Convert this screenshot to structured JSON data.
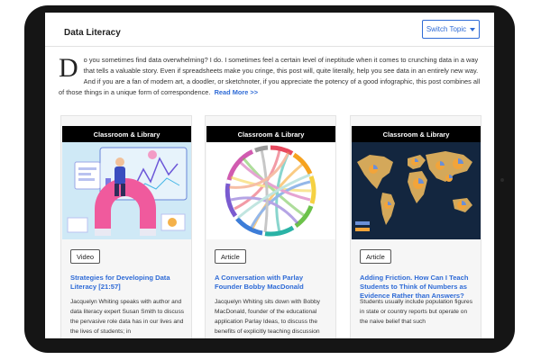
{
  "page": {
    "title": "Data Literacy",
    "switch_topic_label": "Switch Topic"
  },
  "intro": {
    "dropcap": "D",
    "text": "o you sometimes find data overwhelming? I do. I sometimes feel a certain level of ineptitude when it comes to crunching data in a way that tells a valuable story. Even if spreadsheets make you cringe, this post will, quite literally, help you see data in an entirely new way. And if you are a fan of modern art, a doodler, or sketchnoter, if you appreciate the potency of a good infographic, this post combines all of those things in a unique form of correspondence.",
    "read_more": "Read More >>"
  },
  "cards": [
    {
      "category": "Classroom & Library",
      "type": "Video",
      "title": "Strategies for Developing Data Literacy [21:57]",
      "description": "Jacquelyn Whiting speaks with author and data literacy expert Susan Smith to discuss the pervasive role data has in our lives and the lives of students; in"
    },
    {
      "category": "Classroom & Library",
      "type": "Article",
      "title": "A Conversation with Parlay Founder Bobby MacDonald",
      "description": "Jacquelyn Whiting sits down with Bobby MacDonald, founder of the educational application Parlay Ideas, to discuss the benefits of explicitly teaching discussion"
    },
    {
      "category": "Classroom & Library",
      "type": "Article",
      "title": "Adding Friction. How Can I Teach Students to Think of Numbers as Evidence Rather than Answers?",
      "description": "Students usually include population figures in state or country reports but operate on the naive belief that such"
    }
  ],
  "colors": {
    "accent": "#2f6bd6",
    "band": "#000000",
    "tablet": "#151515"
  }
}
